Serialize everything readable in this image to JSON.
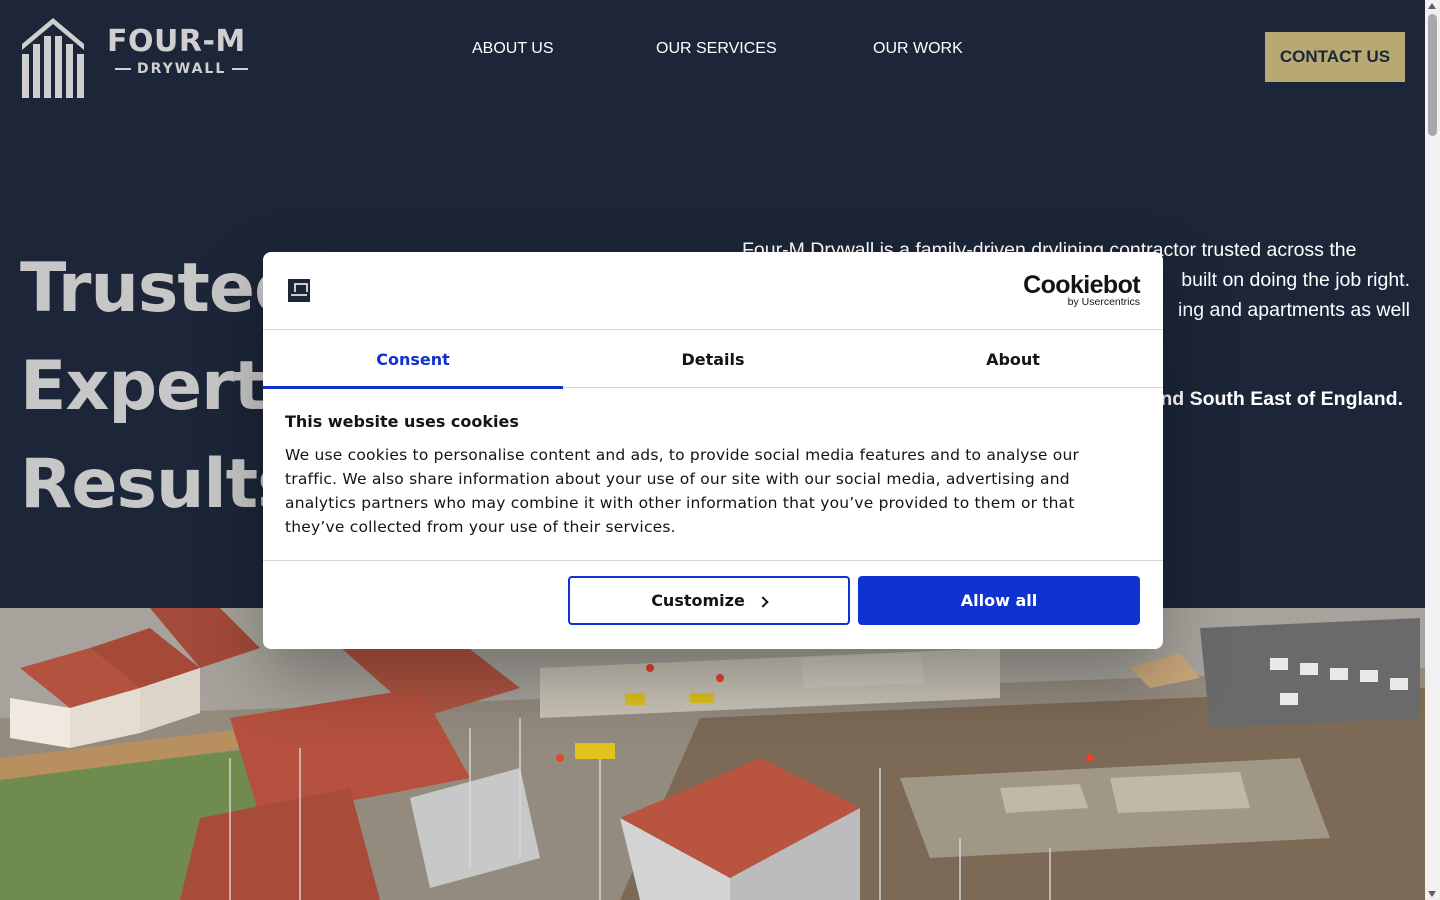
{
  "brand": {
    "wordmark": "FOUR-M",
    "sub": "DRYWALL"
  },
  "nav": {
    "items": [
      "ABOUT US",
      "OUR SERVICES",
      "OUR WORK"
    ],
    "cta": "CONTACT US"
  },
  "hero": {
    "title_lines": [
      "Trusted",
      "Experts",
      "Results"
    ],
    "intro_lines": [
      "Four-M Drywall is a family-driven drylining contractor trusted across the",
      "built on doing the job right.",
      "ing and apartments as well"
    ],
    "region": "nd South East of England.",
    "image_alt": "Aerial view of a housing construction site"
  },
  "cookie": {
    "brand_name": "Cookiebot",
    "brand_by": "by Usercentrics",
    "tabs": [
      "Consent",
      "Details",
      "About"
    ],
    "active_tab": "Consent",
    "heading": "This website uses cookies",
    "body": "We use cookies to personalise content and ads, to provide social media features and to analyse our traffic. We also share information about your use of our site with our social media, advertising and analytics partners who may combine it with other information that you’ve provided to them or that they’ve collected from your use of their services.",
    "customize_label": "Customize",
    "allow_label": "Allow all"
  },
  "colors": {
    "navy": "#1c2638",
    "gold": "#b8a874",
    "cookie_blue": "#1032cf"
  }
}
